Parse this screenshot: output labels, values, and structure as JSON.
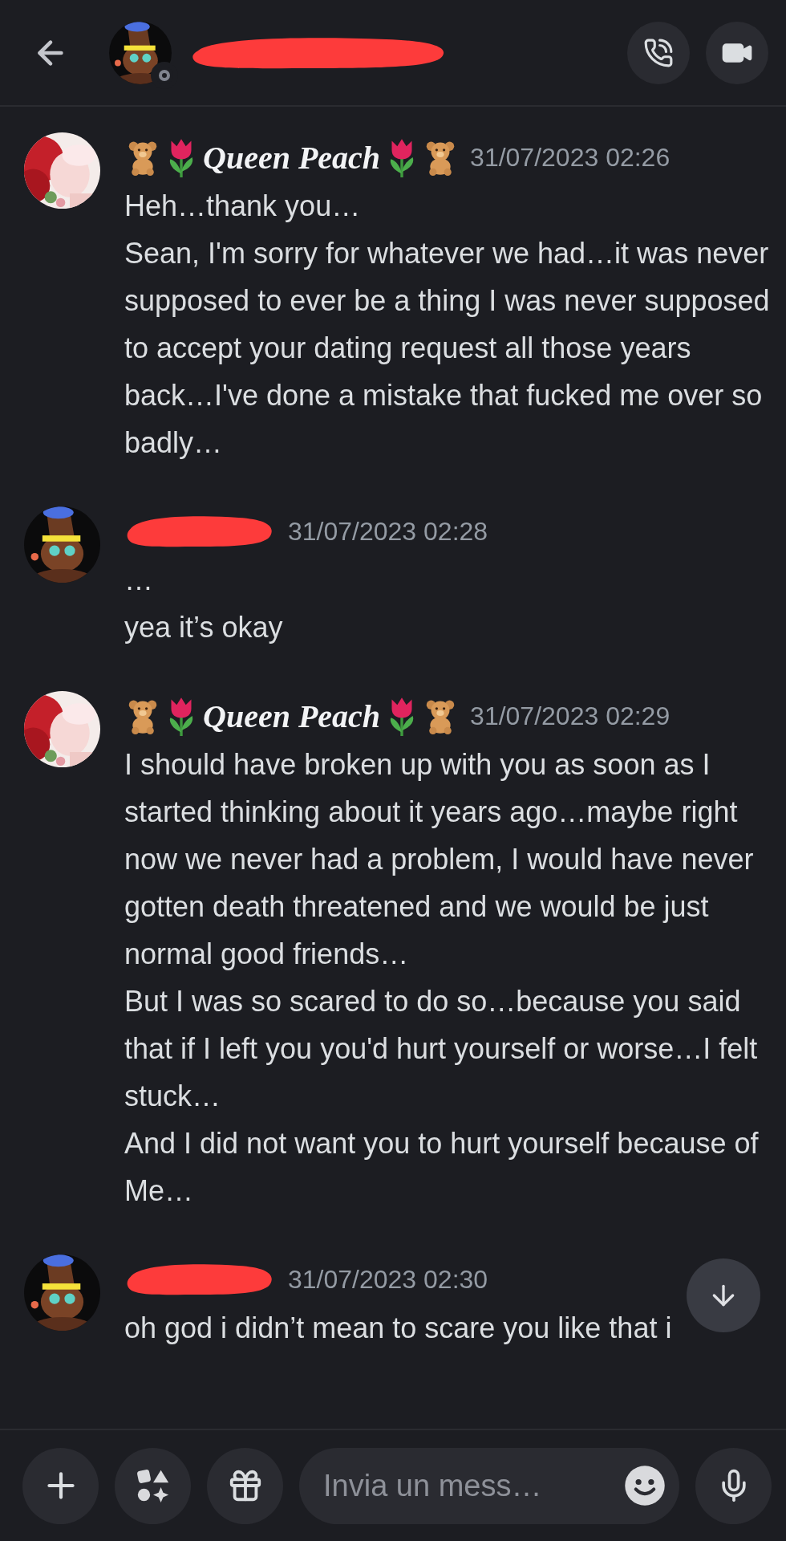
{
  "messages": [
    {
      "author": {
        "name": "Queen Peach",
        "redacted": false,
        "decorated": true
      },
      "timestamp": "31/07/2023 02:26",
      "paragraphs": [
        "Heh…thank you…",
        "Sean, I'm sorry for whatever we had…it was never supposed to ever be a thing I was never supposed to accept your dating request all those years back…I've done a mistake that fucked me over so badly…"
      ]
    },
    {
      "author": {
        "redacted": true
      },
      "timestamp": "31/07/2023 02:28",
      "paragraphs": [
        "…",
        "yea it’s okay"
      ]
    },
    {
      "author": {
        "name": "Queen Peach",
        "redacted": false,
        "decorated": true
      },
      "timestamp": "31/07/2023 02:29",
      "paragraphs": [
        "I should have broken up with you as soon as I started thinking about it years ago…maybe right now we never had a problem, I would have never gotten death threatened and we would be just normal good friends…",
        "But I was so scared to do so…because you said that if I left you you'd hurt yourself or worse…I felt stuck…",
        "And I did not want you to hurt yourself because of Me…"
      ]
    },
    {
      "author": {
        "redacted": true
      },
      "timestamp": "31/07/2023 02:30",
      "paragraphs": [
        "oh god i didn’t mean to scare you like that i"
      ]
    }
  ],
  "composer": {
    "placeholder": "Invia un mess…"
  }
}
